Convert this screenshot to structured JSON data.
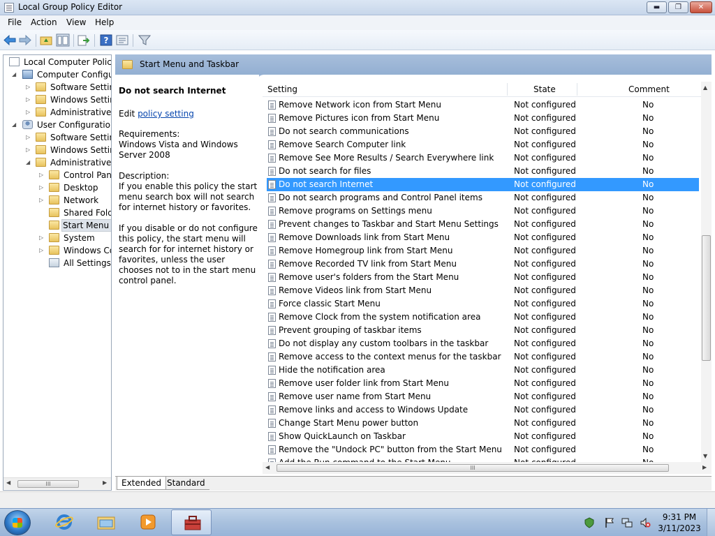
{
  "window": {
    "title": "Local Group Policy Editor",
    "minimize": "▬",
    "maximize": "❐",
    "close": "✕"
  },
  "menu": [
    "File",
    "Action",
    "View",
    "Help"
  ],
  "toolbar_icons": [
    "back-arrow-icon",
    "forward-arrow-icon",
    "up-folder-icon",
    "show-hide-tree-icon",
    "export-list-icon",
    "help-icon",
    "properties-icon",
    "filter-icon"
  ],
  "tree": {
    "root": "Local Computer Policy",
    "computer_config": "Computer Configura",
    "cc_software": "Software Settings",
    "cc_windows": "Windows Setting",
    "cc_admin": "Administrative Te",
    "user_config": "User Configuration",
    "uc_software": "Software Settings",
    "uc_windows": "Windows Setting",
    "uc_admin": "Administrative Te",
    "control_panel": "Control Panel",
    "desktop": "Desktop",
    "network": "Network",
    "shared_folders": "Shared Folder",
    "start_menu": "Start Menu ar",
    "system": "System",
    "windows_components": "Windows Cor",
    "all_settings": "All Settings"
  },
  "pane_header": "Start Menu and Taskbar",
  "description": {
    "title": "Do not search Internet",
    "edit_prefix": "Edit ",
    "edit_link": "policy setting",
    "requirements_label": "Requirements:",
    "requirements_text": "Windows Vista and Windows Server 2008",
    "description_label": "Description:",
    "para1": "If you enable this policy the start menu search box will not search for internet history or favorites.",
    "para2": "If you disable or do not configure this policy, the start menu will search for for internet history or favorites, unless the user chooses not to in the start menu control panel."
  },
  "columns": {
    "setting": "Setting",
    "state": "State",
    "comment": "Comment"
  },
  "selected_row": 6,
  "rows": [
    {
      "setting": "Remove Network icon from Start Menu",
      "state": "Not configured",
      "comment": "No"
    },
    {
      "setting": "Remove Pictures icon from Start Menu",
      "state": "Not configured",
      "comment": "No"
    },
    {
      "setting": "Do not search communications",
      "state": "Not configured",
      "comment": "No"
    },
    {
      "setting": "Remove Search Computer link",
      "state": "Not configured",
      "comment": "No"
    },
    {
      "setting": "Remove See More Results / Search Everywhere link",
      "state": "Not configured",
      "comment": "No"
    },
    {
      "setting": "Do not search for files",
      "state": "Not configured",
      "comment": "No"
    },
    {
      "setting": "Do not search Internet",
      "state": "Not configured",
      "comment": "No"
    },
    {
      "setting": "Do not search programs and Control Panel items",
      "state": "Not configured",
      "comment": "No"
    },
    {
      "setting": "Remove programs on Settings menu",
      "state": "Not configured",
      "comment": "No"
    },
    {
      "setting": "Prevent changes to Taskbar and Start Menu Settings",
      "state": "Not configured",
      "comment": "No"
    },
    {
      "setting": "Remove Downloads link from Start Menu",
      "state": "Not configured",
      "comment": "No"
    },
    {
      "setting": "Remove Homegroup link from Start Menu",
      "state": "Not configured",
      "comment": "No"
    },
    {
      "setting": "Remove Recorded TV link from Start Menu",
      "state": "Not configured",
      "comment": "No"
    },
    {
      "setting": "Remove user's folders from the Start Menu",
      "state": "Not configured",
      "comment": "No"
    },
    {
      "setting": "Remove Videos link from Start Menu",
      "state": "Not configured",
      "comment": "No"
    },
    {
      "setting": "Force classic Start Menu",
      "state": "Not configured",
      "comment": "No"
    },
    {
      "setting": "Remove Clock from the system notification area",
      "state": "Not configured",
      "comment": "No"
    },
    {
      "setting": "Prevent grouping of taskbar items",
      "state": "Not configured",
      "comment": "No"
    },
    {
      "setting": "Do not display any custom toolbars in the taskbar",
      "state": "Not configured",
      "comment": "No"
    },
    {
      "setting": "Remove access to the context menus for the taskbar",
      "state": "Not configured",
      "comment": "No"
    },
    {
      "setting": "Hide the notification area",
      "state": "Not configured",
      "comment": "No"
    },
    {
      "setting": "Remove user folder link from Start Menu",
      "state": "Not configured",
      "comment": "No"
    },
    {
      "setting": "Remove user name from Start Menu",
      "state": "Not configured",
      "comment": "No"
    },
    {
      "setting": "Remove links and access to Windows Update",
      "state": "Not configured",
      "comment": "No"
    },
    {
      "setting": "Change Start Menu power button",
      "state": "Not configured",
      "comment": "No"
    },
    {
      "setting": "Show QuickLaunch on Taskbar",
      "state": "Not configured",
      "comment": "No"
    },
    {
      "setting": "Remove the \"Undock PC\" button from the Start Menu",
      "state": "Not configured",
      "comment": "No"
    },
    {
      "setting": "Add the Run command to the Start Menu",
      "state": "Not configured",
      "comment": "No"
    }
  ],
  "tabs": {
    "extended": "Extended",
    "standard": "Standard"
  },
  "scroll": {
    "grip": "III",
    "left": "◀",
    "right": "▶",
    "up": "▲",
    "down": "▼"
  },
  "taskbar": {
    "apps": [
      "internet-explorer-icon",
      "windows-explorer-icon",
      "media-player-icon",
      "group-policy-editor-icon"
    ],
    "tray_icons": [
      "action-center-icon",
      "flag-icon",
      "network-icon",
      "volume-muted-icon"
    ],
    "time": "9:31 PM",
    "date": "3/11/2023"
  }
}
